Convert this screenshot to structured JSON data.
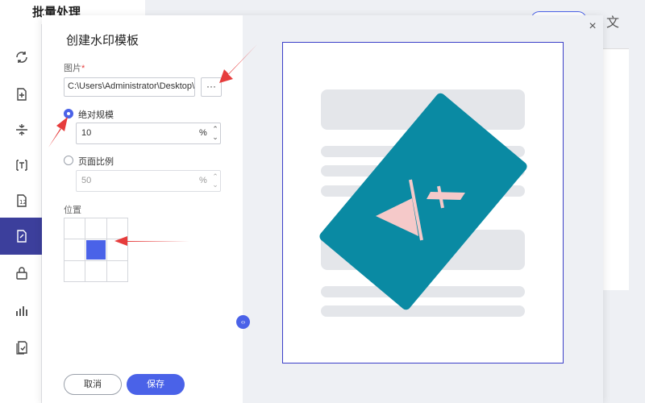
{
  "app": {
    "title": "批量处理",
    "corner_icon": "文"
  },
  "sidebar": {
    "items": [
      {
        "name": "convert-icon"
      },
      {
        "name": "add-file-icon"
      },
      {
        "name": "compress-icon"
      },
      {
        "name": "text-icon"
      },
      {
        "name": "page-number-icon"
      },
      {
        "name": "watermark-icon",
        "active": true
      },
      {
        "name": "lock-icon"
      },
      {
        "name": "chart-icon"
      },
      {
        "name": "check-file-icon"
      }
    ]
  },
  "dialog": {
    "title": "创建水印模板",
    "close_label": "×",
    "image": {
      "label": "图片",
      "required_mark": "*",
      "path_value": "C:\\Users\\Administrator\\Desktop\\",
      "browse_label": "···"
    },
    "scale_mode": {
      "absolute": {
        "label": "绝对规模",
        "value": "10",
        "unit": "%",
        "selected": true
      },
      "page_ratio": {
        "label": "页面比例",
        "value": "50",
        "unit": "%",
        "selected": false
      }
    },
    "position": {
      "label": "位置",
      "selected_cell": 4
    },
    "buttons": {
      "cancel": "取消",
      "save": "保存"
    },
    "toggle_label": "‹›"
  },
  "colors": {
    "accent": "#4a62e8",
    "watermark": "#0a8aa3",
    "watermark_mark": "#f5c9c9",
    "arrow": "#e63c3c",
    "page_border": "#3b3fc8"
  }
}
